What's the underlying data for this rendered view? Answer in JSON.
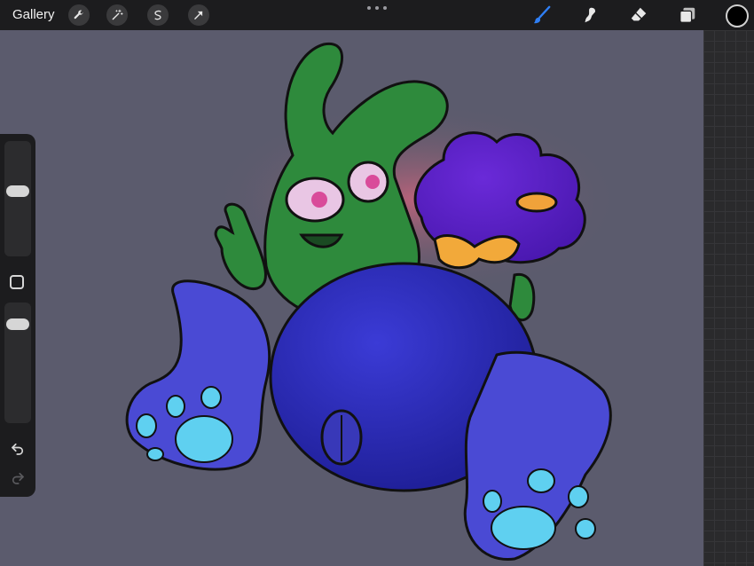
{
  "topbar": {
    "gallery_label": "Gallery",
    "left_tools": [
      "wrench-icon",
      "magic-wand-icon",
      "selection-icon",
      "transform-arrow-icon"
    ],
    "right_tools": [
      "brush-icon",
      "smudge-icon",
      "eraser-icon",
      "layers-icon"
    ],
    "active_tool": "brush-icon",
    "accent_color": "#2f7ff5",
    "current_color": "#000000"
  },
  "sidebar": {
    "brush_size": 0.58,
    "opacity": 0.88,
    "undo_icon": "undo-icon",
    "redo_icon": "redo-icon"
  },
  "canvas": {
    "background_color": "#5b5b6d"
  }
}
